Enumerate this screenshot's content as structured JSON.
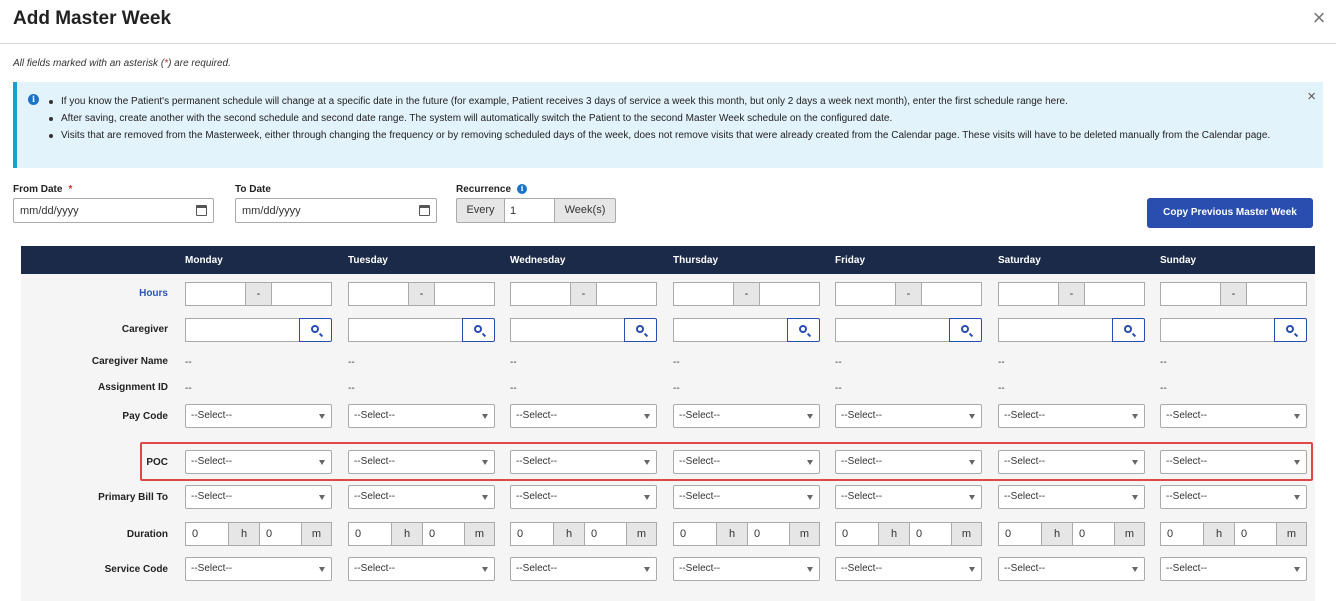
{
  "dialog": {
    "title": "Add Master Week",
    "close_icon": "×"
  },
  "required_note": {
    "before": "All fields marked with an asterisk (",
    "star": "*",
    "after": ") are required."
  },
  "info": {
    "bullets": [
      "If you know the Patient's permanent schedule will change at a specific date in the future (for example, Patient receives 3 days of service a week this month, but only 2 days a week next month), enter the first schedule range here.",
      "After saving, create another with the second schedule and second date range. The system will automatically switch the Patient to the second Master Week schedule on the configured date.",
      "Visits that are removed from the Masterweek, either through changing the frequency or by removing scheduled days of the week, does not remove visits that were already created from the Calendar page. These visits will have to be deleted manually from the Calendar page."
    ],
    "close_icon": "×"
  },
  "form": {
    "from_date": {
      "label": "From Date",
      "required_star": "*",
      "placeholder": "mm/dd/yyyy"
    },
    "to_date": {
      "label": "To Date",
      "placeholder": "mm/dd/yyyy"
    },
    "recurrence": {
      "label": "Recurrence",
      "prefix": "Every",
      "value": "1",
      "unit": "Week(s)"
    },
    "copy_button": "Copy Previous Master Week"
  },
  "schedule": {
    "days": [
      "Monday",
      "Tuesday",
      "Wednesday",
      "Thursday",
      "Friday",
      "Saturday",
      "Sunday"
    ],
    "row_labels": {
      "hours": "Hours",
      "caregiver": "Caregiver",
      "caregiver_name": "Caregiver Name",
      "assignment_id": "Assignment ID",
      "pay_code": "Pay Code",
      "poc": "POC",
      "primary_bill_to": "Primary Bill To",
      "duration": "Duration",
      "service_code": "Service Code"
    },
    "hours_separator": "-",
    "empty_value": "--",
    "select_placeholder": "--Select--",
    "duration": {
      "hours": "0",
      "hours_unit": "h",
      "minutes": "0",
      "minutes_unit": "m"
    }
  }
}
